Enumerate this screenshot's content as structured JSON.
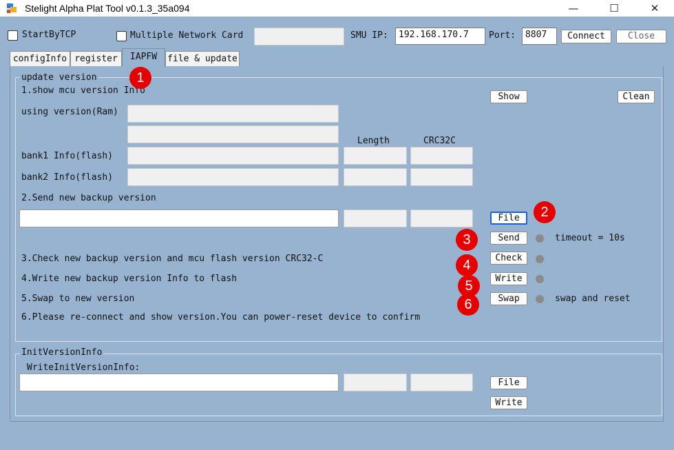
{
  "window": {
    "title": "Stelight Alpha Plat Tool v0.1.3_35a094",
    "minimize": "—",
    "maximize": "☐",
    "close": "✕"
  },
  "connection": {
    "start_by_tcp": "StartByTCP",
    "multiple_network_card": "Multiple Network Card",
    "smu_ip_label": "SMU IP:",
    "smu_ip_value": "192.168.170.7",
    "port_label": "Port:",
    "port_value": "8807",
    "connect": "Connect",
    "close": "Close"
  },
  "tabs": [
    {
      "label": "configInfo"
    },
    {
      "label": "register"
    },
    {
      "label": "IAPFW",
      "active": true
    },
    {
      "label": "file & update"
    }
  ],
  "update_version": {
    "group_title": "update version",
    "step1": "1.show mcu version Info",
    "show": "Show",
    "clean": "Clean",
    "using_version": "using version(Ram)",
    "col_length": "Length",
    "col_crc": "CRC32C",
    "bank1": "bank1 Info(flash)",
    "bank2": "bank2 Info(flash)",
    "step2": "2.Send new backup version",
    "file": "File",
    "send": "Send",
    "timeout": "timeout = 10s",
    "step3": "3.Check new backup version and mcu flash version CRC32-C",
    "check": "Check",
    "step4": "4.Write new backup version Info to flash",
    "write": "Write",
    "step5": "5.Swap to new version",
    "swap": "Swap",
    "swap_note": "swap and reset",
    "step6": "6.Please re-connect and show version.You can power-reset device to confirm"
  },
  "init_version": {
    "group_title": "InitVersionInfo",
    "label": "WriteInitVersionInfo:",
    "file": "File",
    "write": "Write"
  },
  "annotations": [
    "1",
    "2",
    "3",
    "4",
    "5",
    "6"
  ],
  "colors": {
    "background": "#98b3d0",
    "badge": "#e60000",
    "led": "#8a8a8a",
    "focus": "#1a5fd6"
  }
}
